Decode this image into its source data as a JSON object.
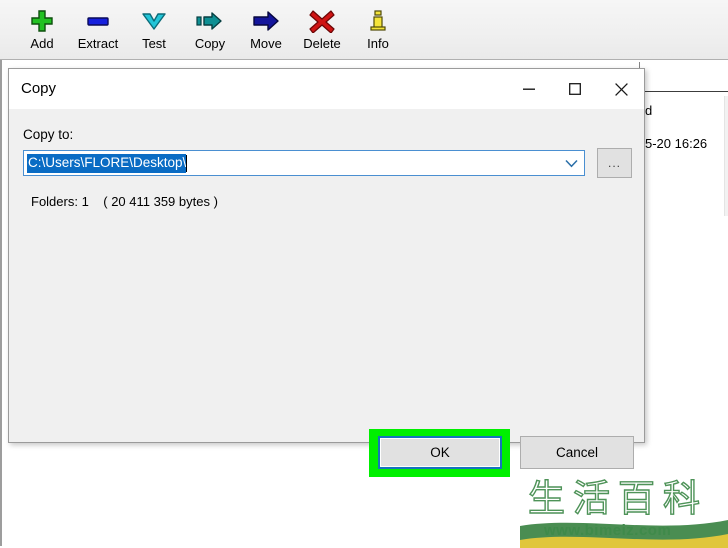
{
  "app": {
    "toolbar": {
      "buttons": [
        {
          "label": "Add",
          "icon": "plus-icon"
        },
        {
          "label": "Extract",
          "icon": "minus-bar-icon"
        },
        {
          "label": "Test",
          "icon": "chevron-down-icon"
        },
        {
          "label": "Copy",
          "icon": "copy-arrow-icon"
        },
        {
          "label": "Move",
          "icon": "move-arrow-icon"
        },
        {
          "label": "Delete",
          "icon": "red-x-icon"
        },
        {
          "label": "Info",
          "icon": "info-i-icon"
        }
      ]
    },
    "file_list": {
      "column_header_partial": "d",
      "row_date_partial": "5-20 16:26"
    }
  },
  "dialog": {
    "title": "Copy",
    "window_controls": {
      "minimize": "minimize-icon",
      "maximize": "maximize-icon",
      "close": "close-icon"
    },
    "copy_to_label": "Copy to:",
    "path": {
      "value": "C:\\Users\\FLORE\\Desktop\\",
      "placeholder": "C:\\Users\\FLORE\\Desktop\\",
      "selected": true
    },
    "browse_button_label": "...",
    "folders_info": "Folders: 1    ( 20 411 359 bytes )",
    "buttons": {
      "ok": "OK",
      "cancel": "Cancel"
    }
  },
  "annotation": {
    "highlight_color": "#00ef00",
    "focus_color": "#1673bd",
    "target": "OK"
  },
  "watermark": {
    "cjk_text": "生活百科",
    "url": "www.bimeiz.com",
    "color": "#3f8a4a"
  }
}
